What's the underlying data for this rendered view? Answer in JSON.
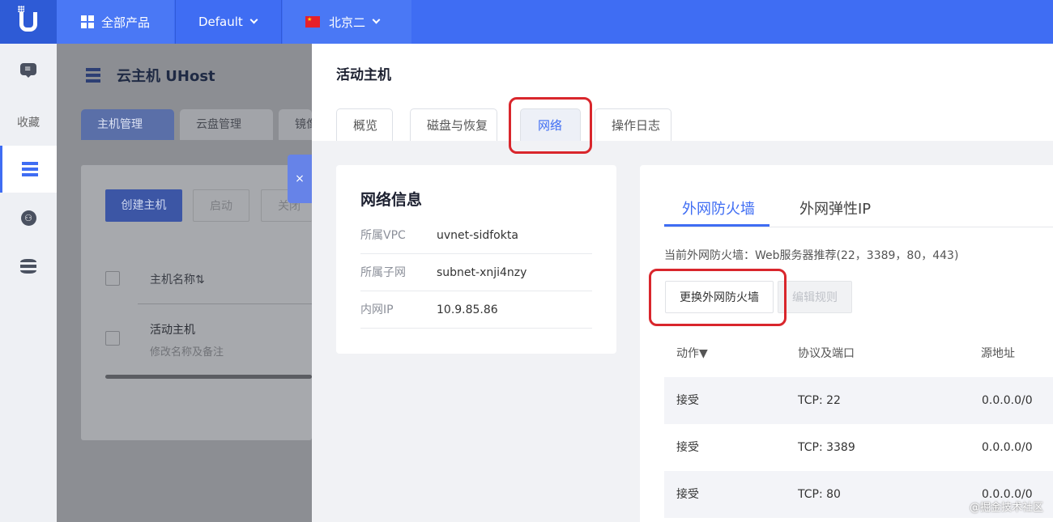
{
  "topbar": {
    "products": "全部产品",
    "project": "Default",
    "region": "北京二"
  },
  "sidebar": {
    "favorites": "收藏"
  },
  "background": {
    "title": "云主机 UHost",
    "tabs": [
      "主机管理",
      "云盘管理",
      "镜像"
    ],
    "buttons": {
      "create": "创建主机",
      "start": "启动",
      "stop": "关闭"
    },
    "table": {
      "col_name": "主机名称⇅",
      "row_name": "活动主机",
      "row_sub": "修改名称及备注"
    }
  },
  "drawer": {
    "close": "×",
    "title": "活动主机",
    "tabs": {
      "overview": "概览",
      "disk": "磁盘与恢复",
      "network": "网络",
      "log": "操作日志"
    },
    "info": {
      "title": "网络信息",
      "rows": [
        {
          "k": "所属VPC",
          "v": "uvnet-sidfokta"
        },
        {
          "k": "所属子网",
          "v": "subnet-xnji4nzy"
        },
        {
          "k": "内网IP",
          "v": "10.9.85.86"
        }
      ]
    },
    "firewall": {
      "tabs": [
        "外网防火墙",
        "外网弹性IP"
      ],
      "current": "当前外网防火墙：Web服务器推荐(22，3389，80，443)",
      "change_button": "更换外网防火墙",
      "edit_button": "编辑规则",
      "headers": {
        "action": "动作▼",
        "protocol": "协议及端口",
        "source": "源地址"
      },
      "rows": [
        {
          "action": "接受",
          "protocol": "TCP: 22",
          "source": "0.0.0.0/0"
        },
        {
          "action": "接受",
          "protocol": "TCP: 3389",
          "source": "0.0.0.0/0"
        },
        {
          "action": "接受",
          "protocol": "TCP: 80",
          "source": "0.0.0.0/0"
        }
      ]
    }
  },
  "watermark": "@掘金技术社区",
  "colors": {
    "primary": "#3f6df3",
    "highlight": "#d9262c"
  }
}
